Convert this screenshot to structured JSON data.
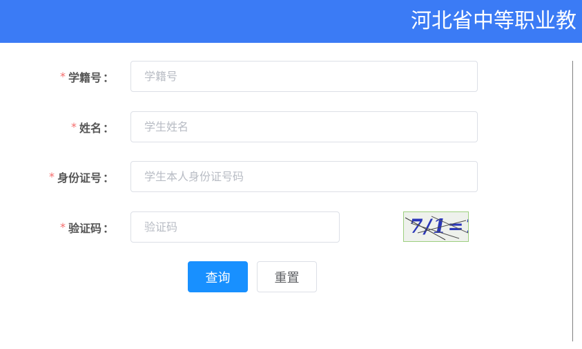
{
  "header": {
    "title": "河北省中等职业教"
  },
  "form": {
    "fields": [
      {
        "label": "学籍号",
        "required_mark": "*",
        "colon": "：",
        "placeholder": "学籍号",
        "value": ""
      },
      {
        "label": "姓名",
        "required_mark": "*",
        "colon": "：",
        "placeholder": "学生姓名",
        "value": ""
      },
      {
        "label": "身份证号",
        "required_mark": "*",
        "colon": "：",
        "placeholder": "学生本人身份证号码",
        "value": ""
      },
      {
        "label": "验证码",
        "required_mark": "*",
        "colon": "：",
        "placeholder": "验证码",
        "value": ""
      }
    ],
    "captcha_text": "7/1=?",
    "buttons": {
      "query_label": "查询",
      "reset_label": "重置"
    }
  },
  "colors": {
    "header_bg": "#3b7bf5",
    "required": "#f56c6c",
    "primary": "#1890ff"
  }
}
